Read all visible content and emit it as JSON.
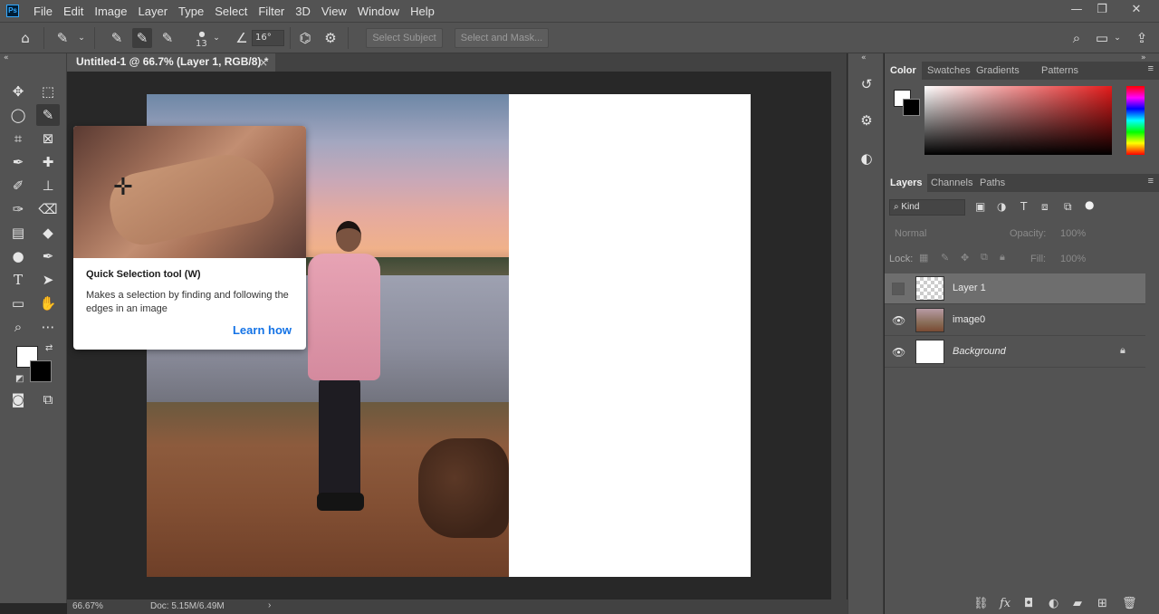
{
  "menu": {
    "logo": "Ps",
    "items": [
      "File",
      "Edit",
      "Image",
      "Layer",
      "Type",
      "Select",
      "Filter",
      "3D",
      "View",
      "Window",
      "Help"
    ],
    "minimize": "—",
    "restore": "❐",
    "close": "✕"
  },
  "options": {
    "brush_size": "13",
    "angle": "16°",
    "select_subject": "Select Subject",
    "select_and_mask": "Select and Mask..."
  },
  "document": {
    "tab_title": "Untitled-1 @ 66.7% (Layer 1, RGB/8) *",
    "tab_close": "×"
  },
  "tooltip": {
    "title": "Quick Selection tool (W)",
    "body": "Makes a selection by finding and following the edges in an image",
    "link": "Learn how"
  },
  "status": {
    "zoom": "66.67%",
    "doc": "Doc: 5.15M/6.49M",
    "arrow": "›"
  },
  "color_panel": {
    "tabs": [
      "Color",
      "Swatches",
      "Gradients",
      "Patterns"
    ],
    "foreground": "#ffffff",
    "background": "#000000"
  },
  "layers_panel": {
    "tabs": [
      "Layers",
      "Channels",
      "Paths"
    ],
    "filter_kind": "Kind",
    "blend_mode": "Normal",
    "opacity_label": "Opacity:",
    "opacity_value": "100%",
    "lock_label": "Lock:",
    "fill_label": "Fill:",
    "fill_value": "100%",
    "layers": [
      {
        "name": "Layer 1",
        "visible": false,
        "selected": true
      },
      {
        "name": "image0",
        "visible": true,
        "selected": false
      },
      {
        "name": "Background",
        "visible": true,
        "selected": false,
        "locked": true
      }
    ]
  }
}
